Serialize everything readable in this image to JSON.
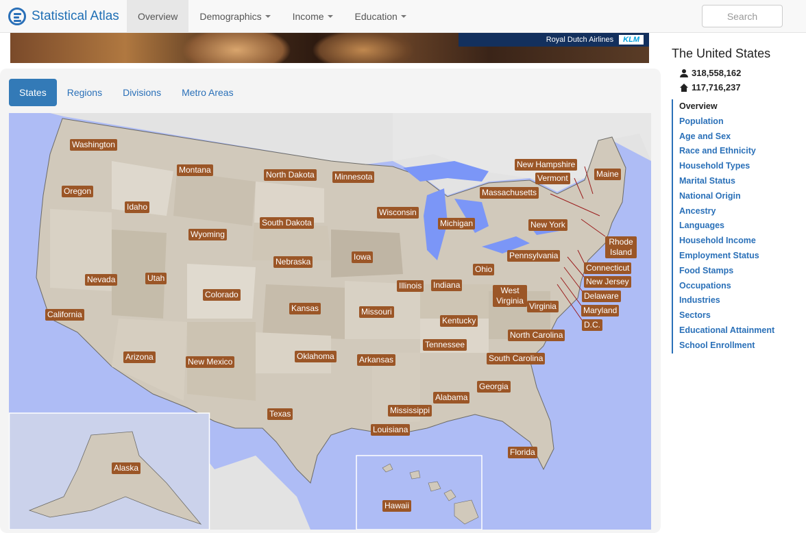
{
  "brand": {
    "name": "Statistical Atlas",
    "logo_icon": "atlas-logo-icon"
  },
  "topnav": {
    "tabs": [
      {
        "label": "Overview",
        "active": true
      },
      {
        "label": "Demographics",
        "dropdown": true
      },
      {
        "label": "Income",
        "dropdown": true
      },
      {
        "label": "Education",
        "dropdown": true
      }
    ],
    "search_placeholder": "Search"
  },
  "banner": {
    "ad_text": "Royal Dutch Airlines",
    "ad_logo": "KLM"
  },
  "map_tabs": [
    {
      "label": "States",
      "active": true
    },
    {
      "label": "Regions"
    },
    {
      "label": "Divisions"
    },
    {
      "label": "Metro Areas"
    }
  ],
  "map_labels": {
    "washington": "Washington",
    "montana": "Montana",
    "north_dakota": "North Dakota",
    "minnesota": "Minnesota",
    "oregon": "Oregon",
    "idaho": "Idaho",
    "wyoming": "Wyoming",
    "south_dakota": "South Dakota",
    "wisconsin": "Wisconsin",
    "michigan": "Michigan",
    "new_york": "New York",
    "new_hampshire": "New Hampshire",
    "vermont": "Vermont",
    "maine": "Maine",
    "massachusetts": "Massachusetts",
    "rhode_island": "Rhode Island",
    "connecticut": "Connecticut",
    "new_jersey": "New Jersey",
    "delaware": "Delaware",
    "maryland": "Maryland",
    "dc": "D.C.",
    "pennsylvania": "Pennsylvania",
    "ohio": "Ohio",
    "nebraska": "Nebraska",
    "iowa": "Iowa",
    "nevada": "Nevada",
    "utah": "Utah",
    "colorado": "Colorado",
    "illinois": "Illinois",
    "indiana": "Indiana",
    "west_virginia": "West Virginia",
    "virginia": "Virginia",
    "california": "California",
    "kansas": "Kansas",
    "missouri": "Missouri",
    "kentucky": "Kentucky",
    "north_carolina": "North Carolina",
    "tennessee": "Tennessee",
    "arizona": "Arizona",
    "new_mexico": "New Mexico",
    "oklahoma": "Oklahoma",
    "arkansas": "Arkansas",
    "south_carolina": "South Carolina",
    "georgia": "Georgia",
    "alabama": "Alabama",
    "mississippi": "Mississippi",
    "texas": "Texas",
    "louisiana": "Louisiana",
    "florida": "Florida",
    "alaska": "Alaska",
    "hawaii": "Hawaii"
  },
  "sidebar": {
    "title": "The United States",
    "population": "318,558,162",
    "population_icon": "person-icon",
    "households": "117,716,237",
    "households_icon": "house-icon",
    "items": [
      {
        "label": "Overview",
        "active": true
      },
      {
        "label": "Population"
      },
      {
        "label": "Age and Sex"
      },
      {
        "label": "Race and Ethnicity"
      },
      {
        "label": "Household Types"
      },
      {
        "label": "Marital Status"
      },
      {
        "label": "National Origin"
      },
      {
        "label": "Ancestry"
      },
      {
        "label": "Languages"
      },
      {
        "label": "Household Income"
      },
      {
        "label": "Employment Status"
      },
      {
        "label": "Food Stamps"
      },
      {
        "label": "Occupations"
      },
      {
        "label": "Industries"
      },
      {
        "label": "Sectors"
      },
      {
        "label": "Educational Attainment"
      },
      {
        "label": "School Enrollment"
      }
    ]
  },
  "colors": {
    "accent": "#2a70b8",
    "label_bg": "#9b5627",
    "water": "#aebcf5",
    "land": "#d1c9bb"
  }
}
